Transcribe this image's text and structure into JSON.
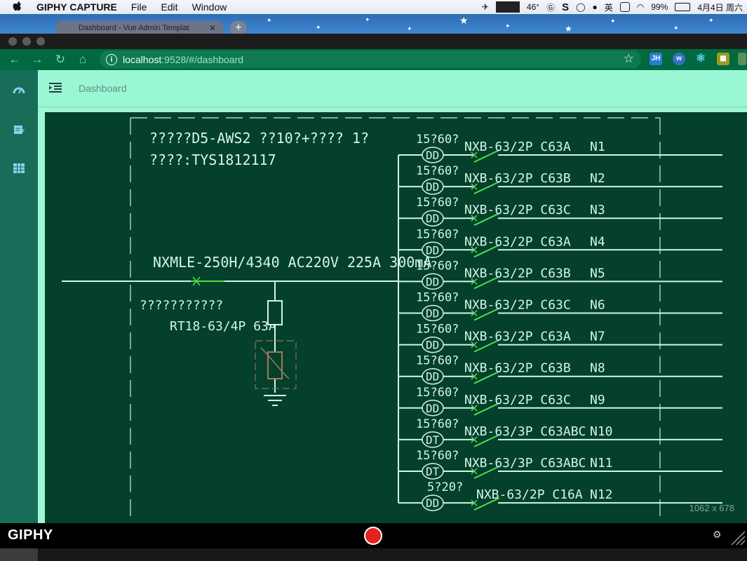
{
  "menubar": {
    "apple_icon": "apple-icon",
    "app_name": "GIPHY CAPTURE",
    "menus": [
      "File",
      "Edit",
      "Window"
    ],
    "temperature": "46°",
    "battery": "99%",
    "ime": "英",
    "datetime": "4月4日 周六"
  },
  "browser": {
    "tab_title": "Dashboard - Vue Admin Templat",
    "url_host": "localhost",
    "url_path": ":9528/#/dashboard",
    "extensions": [
      "JH"
    ]
  },
  "app": {
    "breadcrumb": "Dashboard",
    "sidebar_icons": [
      "dashboard-icon",
      "form-icon",
      "table-icon"
    ]
  },
  "cad": {
    "header_line1": "?????D5-AWS2 ??10?+???? 1?",
    "header_line2": "????:TYS1812117",
    "main_breaker": "NXMLE-250H/4340 AC220V 225A 300mA",
    "spd_label": "???????????",
    "fuse_label": "RT18-63/4P 63A",
    "canvas_size": "1062 x 678",
    "circuits": [
      {
        "power": "15?60?",
        "meter": "DD",
        "model": "NXB-63/2P C63A",
        "name": "N1"
      },
      {
        "power": "15?60?",
        "meter": "DD",
        "model": "NXB-63/2P C63B",
        "name": "N2"
      },
      {
        "power": "15?60?",
        "meter": "DD",
        "model": "NXB-63/2P C63C",
        "name": "N3"
      },
      {
        "power": "15?60?",
        "meter": "DD",
        "model": "NXB-63/2P C63A",
        "name": "N4"
      },
      {
        "power": "15?60?",
        "meter": "DD",
        "model": "NXB-63/2P C63B",
        "name": "N5"
      },
      {
        "power": "15?60?",
        "meter": "DD",
        "model": "NXB-63/2P C63C",
        "name": "N6"
      },
      {
        "power": "15?60?",
        "meter": "DD",
        "model": "NXB-63/2P C63A",
        "name": "N7"
      },
      {
        "power": "15?60?",
        "meter": "DD",
        "model": "NXB-63/2P C63B",
        "name": "N8"
      },
      {
        "power": "15?60?",
        "meter": "DD",
        "model": "NXB-63/2P C63C",
        "name": "N9"
      },
      {
        "power": "15?60?",
        "meter": "DT",
        "model": "NXB-63/3P C63ABC",
        "name": "N10"
      },
      {
        "power": "15?60?",
        "meter": "DT",
        "model": "NXB-63/3P C63ABC",
        "name": "N11"
      },
      {
        "power": "5?20?",
        "meter": "DD",
        "model": "NXB-63/2P C16A",
        "name": "N12"
      }
    ]
  },
  "giphy": {
    "logo": "GIPHY"
  }
}
